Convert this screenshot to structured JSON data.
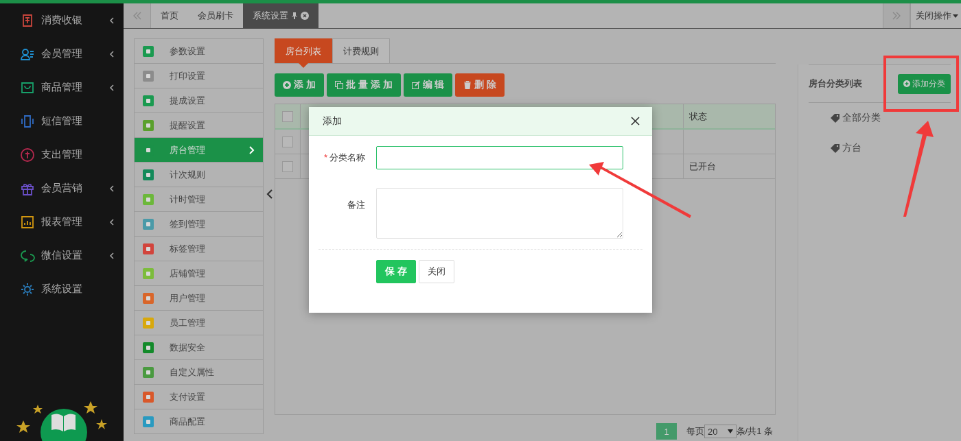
{
  "nav": [
    {
      "label": "消费收银",
      "color": "#c8453c",
      "expandable": true
    },
    {
      "label": "会员管理",
      "color": "#1f8fd0",
      "expandable": true
    },
    {
      "label": "商品管理",
      "color": "#17a06a",
      "expandable": true
    },
    {
      "label": "短信管理",
      "color": "#2f6bc4",
      "expandable": false
    },
    {
      "label": "支出管理",
      "color": "#b5284e",
      "expandable": false
    },
    {
      "label": "会员营销",
      "color": "#6a4fc8",
      "expandable": true
    },
    {
      "label": "报表管理",
      "color": "#d1960f",
      "expandable": true
    },
    {
      "label": "微信设置",
      "color": "#1a9a50",
      "expandable": true
    },
    {
      "label": "系统设置",
      "color": "#2a7fc0",
      "expandable": false
    }
  ],
  "tabs": [
    {
      "label": "首页",
      "selected": false,
      "pinned": false
    },
    {
      "label": "会员刷卡",
      "selected": false,
      "pinned": false
    },
    {
      "label": "系统设置",
      "selected": true,
      "pinned": true
    }
  ],
  "close_menu": "关闭操作",
  "settings_menu": [
    {
      "label": "参数设置",
      "color": "#1a9a50",
      "selected": false
    },
    {
      "label": "打印设置",
      "color": "#8c8c8c",
      "selected": false
    },
    {
      "label": "提成设置",
      "color": "#1a9a50",
      "selected": false
    },
    {
      "label": "提醒设置",
      "color": "#5aa02c",
      "selected": false
    },
    {
      "label": "房台管理",
      "color": "#1a9148",
      "selected": true
    },
    {
      "label": "计次规则",
      "color": "#138a5a",
      "selected": false
    },
    {
      "label": "计时管理",
      "color": "#6cb83a",
      "selected": false
    },
    {
      "label": "签到管理",
      "color": "#4a9aa8",
      "selected": false
    },
    {
      "label": "标签管理",
      "color": "#d2443c",
      "selected": false
    },
    {
      "label": "店铺管理",
      "color": "#7cbc3c",
      "selected": false
    },
    {
      "label": "用户管理",
      "color": "#d9662a",
      "selected": false
    },
    {
      "label": "员工管理",
      "color": "#d8a80c",
      "selected": false
    },
    {
      "label": "数据安全",
      "color": "#138a2a",
      "selected": false
    },
    {
      "label": "自定义属性",
      "color": "#4a9a40",
      "selected": false
    },
    {
      "label": "支付设置",
      "color": "#d9582a",
      "selected": false
    },
    {
      "label": "商品配置",
      "color": "#2a9ac0",
      "selected": false
    }
  ],
  "content_tabs": [
    {
      "label": "房台列表",
      "selected": true
    },
    {
      "label": "计费规则",
      "selected": false
    }
  ],
  "toolbar": [
    {
      "label": "添 加",
      "kind": "add"
    },
    {
      "label": "批 量 添 加",
      "kind": "batch"
    },
    {
      "label": "编 辑",
      "kind": "edit"
    },
    {
      "label": "删 除",
      "kind": "delete"
    }
  ],
  "table": {
    "columns": [
      "状态"
    ],
    "header_checked": false,
    "rows": [
      {
        "checked": false,
        "status": ""
      },
      {
        "checked": false,
        "status": "已开台"
      }
    ]
  },
  "pagination": {
    "page": "1",
    "per_page_label": "每页",
    "per_page": "20",
    "total": "条/共1 条"
  },
  "category_panel": {
    "title": "房台分类列表",
    "add_button": "添加分类",
    "categories": [
      "全部分类",
      "方台"
    ]
  },
  "dialog": {
    "title": "添加",
    "fields": [
      {
        "label": "分类名称",
        "required_mark": "*",
        "kind": "input"
      },
      {
        "label": "备注",
        "kind": "textarea"
      }
    ],
    "buttons": [
      {
        "label": "保 存",
        "kind": "primary"
      },
      {
        "label": "关闭",
        "kind": "default"
      }
    ]
  }
}
